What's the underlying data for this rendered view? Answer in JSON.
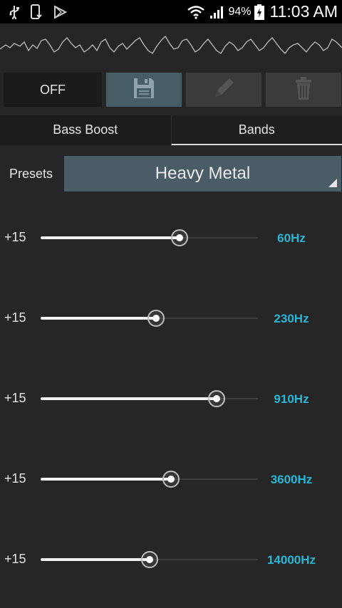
{
  "status_bar": {
    "battery_percent": "94%",
    "time": "11:03 AM",
    "icons": [
      "usb-icon",
      "phone-download-icon",
      "play-store-icon",
      "wifi-icon",
      "signal-icon",
      "battery-charging-icon"
    ]
  },
  "toolbar": {
    "off_label": "OFF",
    "save_icon": "save-icon",
    "edit_icon": "pencil-icon",
    "delete_icon": "trash-icon"
  },
  "tabs": [
    {
      "label": "Bass Boost",
      "selected": false
    },
    {
      "label": "Bands",
      "selected": true
    }
  ],
  "presets": {
    "label": "Presets",
    "selected": "Heavy Metal"
  },
  "bands": [
    {
      "level_label": "+15",
      "frequency": "60Hz",
      "value_fraction": 0.64
    },
    {
      "level_label": "+15",
      "frequency": "230Hz",
      "value_fraction": 0.53
    },
    {
      "level_label": "+15",
      "frequency": "910Hz",
      "value_fraction": 0.81
    },
    {
      "level_label": "+15",
      "frequency": "3600Hz",
      "value_fraction": 0.6
    },
    {
      "level_label": "+15",
      "frequency": "14000Hz",
      "value_fraction": 0.5
    }
  ],
  "colors": {
    "accent": "#2ab6d6",
    "preset_bg": "#4a5d66",
    "save_bg": "#475d66"
  }
}
